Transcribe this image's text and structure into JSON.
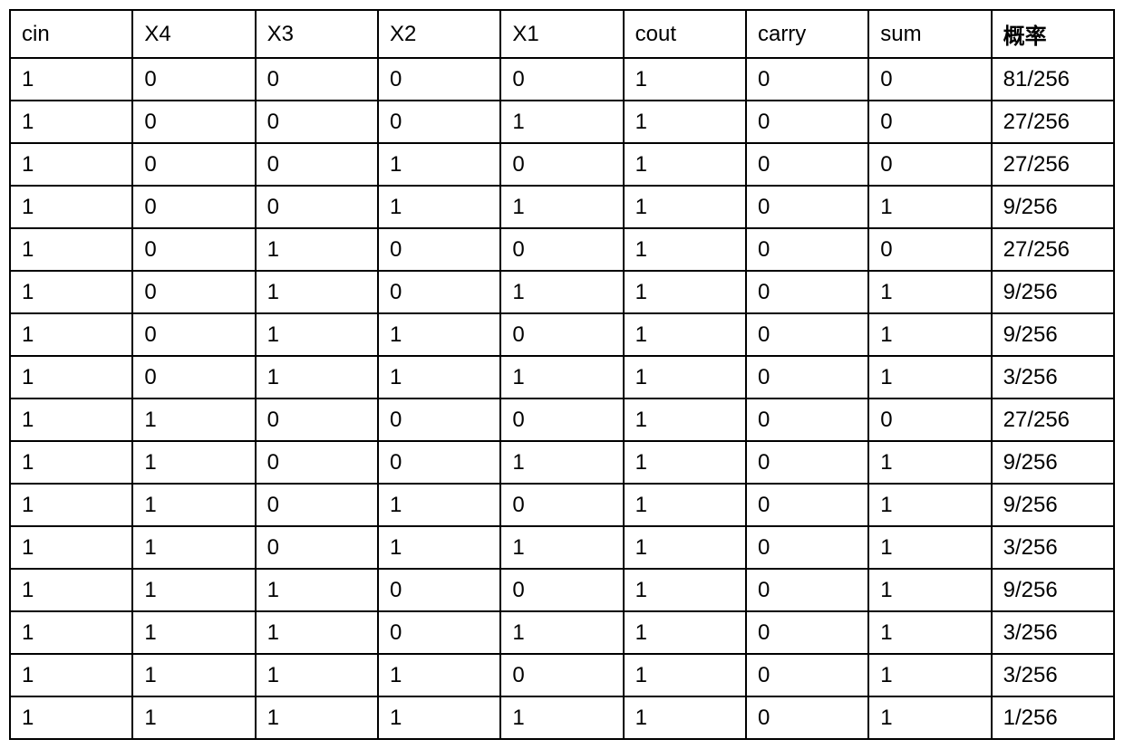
{
  "table": {
    "headers": [
      "cin",
      "X4",
      "X3",
      "X2",
      "X1",
      "cout",
      "carry",
      "sum",
      "概率"
    ],
    "rows": [
      [
        "1",
        "0",
        "0",
        "0",
        "0",
        "1",
        "0",
        "0",
        "81/256"
      ],
      [
        "1",
        "0",
        "0",
        "0",
        "1",
        "1",
        "0",
        "0",
        "27/256"
      ],
      [
        "1",
        "0",
        "0",
        "1",
        "0",
        "1",
        "0",
        "0",
        "27/256"
      ],
      [
        "1",
        "0",
        "0",
        "1",
        "1",
        "1",
        "0",
        "1",
        "9/256"
      ],
      [
        "1",
        "0",
        "1",
        "0",
        "0",
        "1",
        "0",
        "0",
        "27/256"
      ],
      [
        "1",
        "0",
        "1",
        "0",
        "1",
        "1",
        "0",
        "1",
        "9/256"
      ],
      [
        "1",
        "0",
        "1",
        "1",
        "0",
        "1",
        "0",
        "1",
        "9/256"
      ],
      [
        "1",
        "0",
        "1",
        "1",
        "1",
        "1",
        "0",
        "1",
        "3/256"
      ],
      [
        "1",
        "1",
        "0",
        "0",
        "0",
        "1",
        "0",
        "0",
        "27/256"
      ],
      [
        "1",
        "1",
        "0",
        "0",
        "1",
        "1",
        "0",
        "1",
        "9/256"
      ],
      [
        "1",
        "1",
        "0",
        "1",
        "0",
        "1",
        "0",
        "1",
        "9/256"
      ],
      [
        "1",
        "1",
        "0",
        "1",
        "1",
        "1",
        "0",
        "1",
        "3/256"
      ],
      [
        "1",
        "1",
        "1",
        "0",
        "0",
        "1",
        "0",
        "1",
        "9/256"
      ],
      [
        "1",
        "1",
        "1",
        "0",
        "1",
        "1",
        "0",
        "1",
        "3/256"
      ],
      [
        "1",
        "1",
        "1",
        "1",
        "0",
        "1",
        "0",
        "1",
        "3/256"
      ],
      [
        "1",
        "1",
        "1",
        "1",
        "1",
        "1",
        "0",
        "1",
        "1/256"
      ]
    ]
  }
}
